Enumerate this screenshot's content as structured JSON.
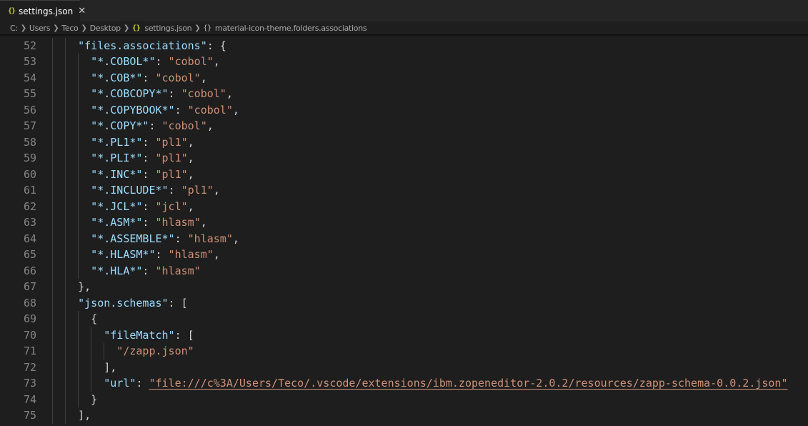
{
  "tab": {
    "icon": "{}",
    "label": "settings.json"
  },
  "breadcrumb": {
    "items": [
      "C:",
      "Users",
      "Teco",
      "Desktop"
    ],
    "file_icon": "{}",
    "file": "settings.json",
    "symbol_icon": "{}",
    "symbol": "material-icon-theme.folders.associations"
  },
  "editor": {
    "lines": [
      {
        "num": "52",
        "indent": 2,
        "parts": [
          [
            "key",
            "\"files.associations\""
          ],
          [
            "pun",
            ": {"
          ]
        ]
      },
      {
        "num": "53",
        "indent": 3,
        "parts": [
          [
            "key",
            "\"*.COBOL*\""
          ],
          [
            "pun",
            ": "
          ],
          [
            "str",
            "\"cobol\""
          ],
          [
            "pun",
            ","
          ]
        ]
      },
      {
        "num": "54",
        "indent": 3,
        "parts": [
          [
            "key",
            "\"*.COB*\""
          ],
          [
            "pun",
            ": "
          ],
          [
            "str",
            "\"cobol\""
          ],
          [
            "pun",
            ","
          ]
        ]
      },
      {
        "num": "55",
        "indent": 3,
        "parts": [
          [
            "key",
            "\"*.COBCOPY*\""
          ],
          [
            "pun",
            ": "
          ],
          [
            "str",
            "\"cobol\""
          ],
          [
            "pun",
            ","
          ]
        ]
      },
      {
        "num": "56",
        "indent": 3,
        "parts": [
          [
            "key",
            "\"*.COPYBOOK*\""
          ],
          [
            "pun",
            ": "
          ],
          [
            "str",
            "\"cobol\""
          ],
          [
            "pun",
            ","
          ]
        ]
      },
      {
        "num": "57",
        "indent": 3,
        "parts": [
          [
            "key",
            "\"*.COPY*\""
          ],
          [
            "pun",
            ": "
          ],
          [
            "str",
            "\"cobol\""
          ],
          [
            "pun",
            ","
          ]
        ]
      },
      {
        "num": "58",
        "indent": 3,
        "parts": [
          [
            "key",
            "\"*.PL1*\""
          ],
          [
            "pun",
            ": "
          ],
          [
            "str",
            "\"pl1\""
          ],
          [
            "pun",
            ","
          ]
        ]
      },
      {
        "num": "59",
        "indent": 3,
        "parts": [
          [
            "key",
            "\"*.PLI*\""
          ],
          [
            "pun",
            ": "
          ],
          [
            "str",
            "\"pl1\""
          ],
          [
            "pun",
            ","
          ]
        ]
      },
      {
        "num": "60",
        "indent": 3,
        "parts": [
          [
            "key",
            "\"*.INC*\""
          ],
          [
            "pun",
            ": "
          ],
          [
            "str",
            "\"pl1\""
          ],
          [
            "pun",
            ","
          ]
        ]
      },
      {
        "num": "61",
        "indent": 3,
        "parts": [
          [
            "key",
            "\"*.INCLUDE*\""
          ],
          [
            "pun",
            ": "
          ],
          [
            "str",
            "\"pl1\""
          ],
          [
            "pun",
            ","
          ]
        ]
      },
      {
        "num": "62",
        "indent": 3,
        "parts": [
          [
            "key",
            "\"*.JCL*\""
          ],
          [
            "pun",
            ": "
          ],
          [
            "str",
            "\"jcl\""
          ],
          [
            "pun",
            ","
          ]
        ]
      },
      {
        "num": "63",
        "indent": 3,
        "parts": [
          [
            "key",
            "\"*.ASM*\""
          ],
          [
            "pun",
            ": "
          ],
          [
            "str",
            "\"hlasm\""
          ],
          [
            "pun",
            ","
          ]
        ]
      },
      {
        "num": "64",
        "indent": 3,
        "parts": [
          [
            "key",
            "\"*.ASSEMBLE*\""
          ],
          [
            "pun",
            ": "
          ],
          [
            "str",
            "\"hlasm\""
          ],
          [
            "pun",
            ","
          ]
        ]
      },
      {
        "num": "65",
        "indent": 3,
        "parts": [
          [
            "key",
            "\"*.HLASM*\""
          ],
          [
            "pun",
            ": "
          ],
          [
            "str",
            "\"hlasm\""
          ],
          [
            "pun",
            ","
          ]
        ]
      },
      {
        "num": "66",
        "indent": 3,
        "parts": [
          [
            "key",
            "\"*.HLA*\""
          ],
          [
            "pun",
            ": "
          ],
          [
            "str",
            "\"hlasm\""
          ]
        ]
      },
      {
        "num": "67",
        "indent": 2,
        "parts": [
          [
            "pun",
            "},"
          ]
        ]
      },
      {
        "num": "68",
        "indent": 2,
        "parts": [
          [
            "key",
            "\"json.schemas\""
          ],
          [
            "pun",
            ": ["
          ]
        ]
      },
      {
        "num": "69",
        "indent": 3,
        "parts": [
          [
            "pun",
            "{"
          ]
        ]
      },
      {
        "num": "70",
        "indent": 4,
        "parts": [
          [
            "key",
            "\"fileMatch\""
          ],
          [
            "pun",
            ": ["
          ]
        ]
      },
      {
        "num": "71",
        "indent": 5,
        "parts": [
          [
            "str",
            "\"/zapp.json\""
          ]
        ]
      },
      {
        "num": "72",
        "indent": 4,
        "parts": [
          [
            "pun",
            "],"
          ]
        ]
      },
      {
        "num": "73",
        "indent": 4,
        "parts": [
          [
            "key",
            "\"url\""
          ],
          [
            "pun",
            ": "
          ],
          [
            "url",
            "\"file:///c%3A/Users/Teco/.vscode/extensions/ibm.zopeneditor-2.0.2/resources/zapp-schema-0.0.2.json\""
          ]
        ]
      },
      {
        "num": "74",
        "indent": 3,
        "parts": [
          [
            "pun",
            "}"
          ]
        ]
      },
      {
        "num": "75",
        "indent": 2,
        "parts": [
          [
            "pun",
            "],"
          ]
        ]
      }
    ]
  }
}
